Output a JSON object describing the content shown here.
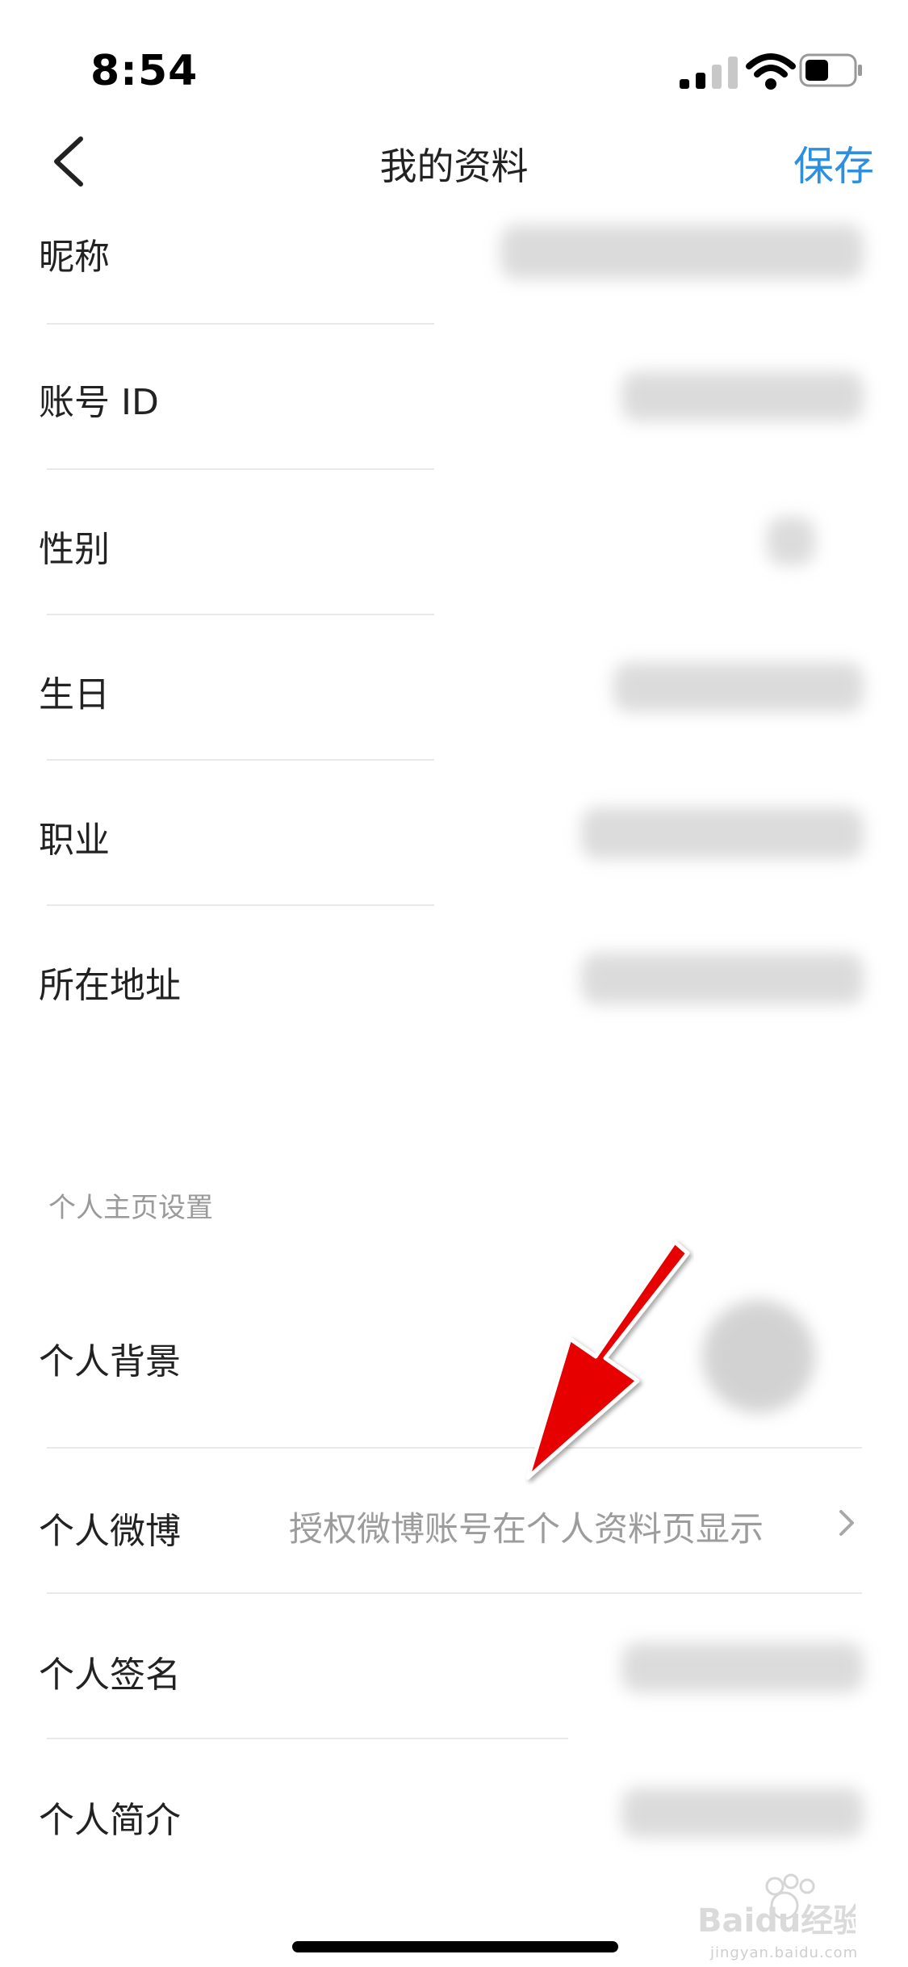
{
  "status_bar": {
    "time": "8:54"
  },
  "nav": {
    "title": "我的资料",
    "save_label": "保存"
  },
  "rows": [
    {
      "label": "昵称"
    },
    {
      "label": "账号 ID"
    },
    {
      "label": "性别"
    },
    {
      "label": "生日"
    },
    {
      "label": "职业"
    },
    {
      "label": "所在地址"
    }
  ],
  "section": {
    "title": "个人主页设置"
  },
  "homepage_rows": [
    {
      "label": "个人背景"
    },
    {
      "label": "个人微博",
      "value": "授权微博账号在个人资料页显示"
    },
    {
      "label": "个人签名"
    },
    {
      "label": "个人简介"
    }
  ],
  "watermark": {
    "logo_text": "Baidu经验",
    "url_text": "jingyan.baidu.com"
  },
  "colors": {
    "accent": "#2f8fdf",
    "annotation_arrow": "#e60000"
  }
}
